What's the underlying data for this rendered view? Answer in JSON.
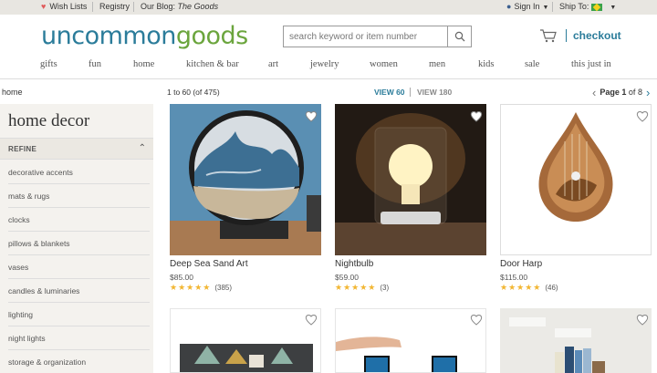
{
  "utility": {
    "wish_lists": "Wish Lists",
    "registry": "Registry",
    "blog_prefix": "Our Blog:",
    "blog_name": "The Goods",
    "sign_in": "Sign In",
    "ship_to": "Ship To:"
  },
  "header": {
    "logo_part1": "uncommon",
    "logo_part2": "goods",
    "search_placeholder": "search keyword or item number",
    "checkout": "checkout"
  },
  "nav": [
    "gifts",
    "fun",
    "home",
    "kitchen & bar",
    "art",
    "jewelry",
    "women",
    "men",
    "kids",
    "sale",
    "this just in"
  ],
  "breadcrumb": "home",
  "results": {
    "count": "1 to 60 (of 475)",
    "view60": "VIEW 60",
    "view180": "VIEW 180",
    "page_label": "Page",
    "page_current": "1",
    "page_of": "of",
    "page_total": "8"
  },
  "sidebar": {
    "title": "home decor",
    "refine": "REFINE",
    "items": [
      "decorative accents",
      "mats & rugs",
      "clocks",
      "pillows & blankets",
      "vases",
      "candles & luminaries",
      "lighting",
      "night lights",
      "storage & organization"
    ]
  },
  "products": [
    {
      "name": "Deep Sea Sand Art",
      "price": "$85.00",
      "stars": "★★★★★",
      "reviews": "(385)",
      "rating": 4.5
    },
    {
      "name": "Nightbulb",
      "price": "$59.00",
      "stars": "★★★★★",
      "reviews": "(3)",
      "rating": 5
    },
    {
      "name": "Door Harp",
      "price": "$115.00",
      "stars": "★★★★★",
      "reviews": "(46)",
      "rating": 4.5
    }
  ],
  "colors": {
    "brand_blue": "#2b7c9a",
    "brand_green": "#6ba53d",
    "star": "#f2b632"
  }
}
